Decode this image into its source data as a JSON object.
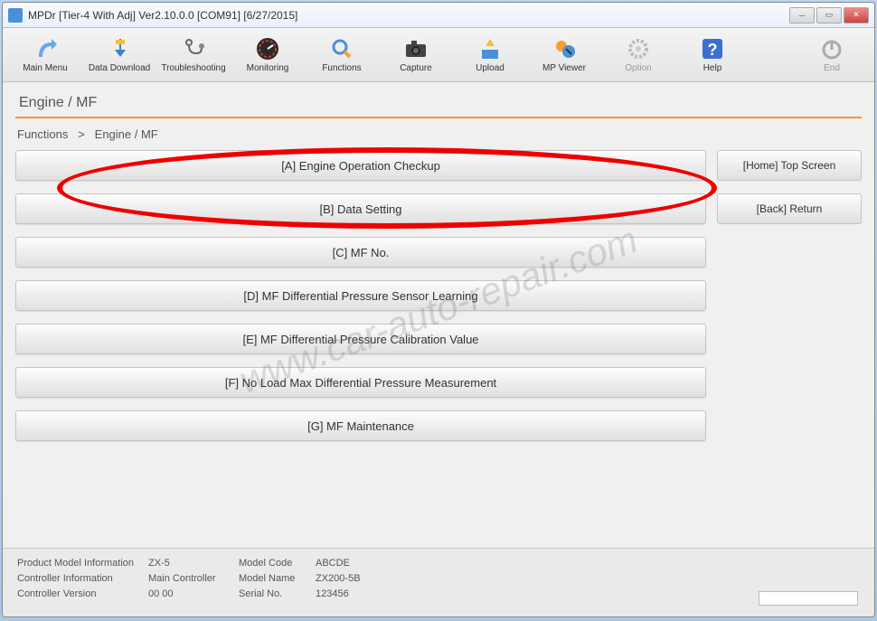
{
  "window": {
    "title": "MPDr [Tier-4 With Adj] Ver2.10.0.0 [COM91] [6/27/2015]"
  },
  "toolbar": {
    "main_menu": "Main Menu",
    "data_download": "Data Download",
    "troubleshooting": "Troubleshooting",
    "monitoring": "Monitoring",
    "functions": "Functions",
    "capture": "Capture",
    "upload": "Upload",
    "mp_viewer": "MP Viewer",
    "option": "Option",
    "help": "Help",
    "end": "End"
  },
  "page": {
    "title": "Engine / MF",
    "breadcrumb_root": "Functions",
    "breadcrumb_sep": ">",
    "breadcrumb_current": "Engine / MF"
  },
  "functions": {
    "a": "[A] Engine Operation Checkup",
    "b": "[B] Data Setting",
    "c": "[C] MF No.",
    "d": "[D] MF Differential Pressure Sensor Learning",
    "e": "[E] MF Differential Pressure Calibration Value",
    "f": "[F] No Load Max Differential Pressure Measurement",
    "g": "[G] MF Maintenance"
  },
  "side": {
    "home": "[Home] Top Screen",
    "back": "[Back] Return"
  },
  "status": {
    "row1": {
      "l1": "Product Model Information",
      "v1": "ZX-5",
      "l2": "Model Code",
      "v2": "ABCDE"
    },
    "row2": {
      "l1": "Controller Information",
      "v1": "Main Controller",
      "l2": "Model Name",
      "v2": "ZX200-5B"
    },
    "row3": {
      "l1": "Controller Version",
      "v1": "00 00",
      "l2": "Serial No.",
      "v2": "123456"
    }
  },
  "watermark": "www.car-auto-repair.com"
}
